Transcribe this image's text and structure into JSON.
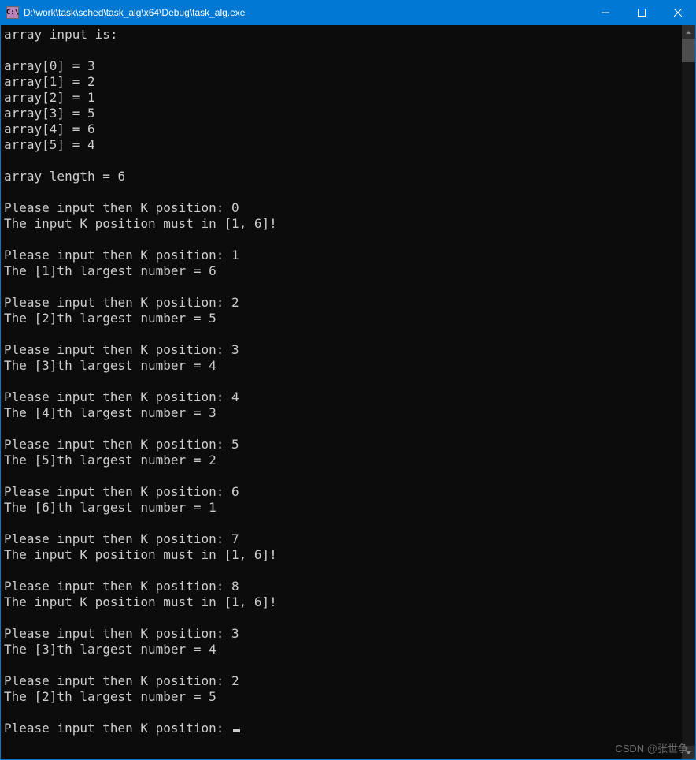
{
  "window": {
    "icon_text": "C:\\",
    "title": "D:\\work\\task\\sched\\task_alg\\x64\\Debug\\task_alg.exe"
  },
  "console": {
    "lines": [
      "array input is:",
      "",
      "array[0] = 3",
      "array[1] = 2",
      "array[2] = 1",
      "array[3] = 5",
      "array[4] = 6",
      "array[5] = 4",
      "",
      "array length = 6",
      "",
      "Please input then K position: 0",
      "The input K position must in [1, 6]!",
      "",
      "Please input then K position: 1",
      "The [1]th largest number = 6",
      "",
      "Please input then K position: 2",
      "The [2]th largest number = 5",
      "",
      "Please input then K position: 3",
      "The [3]th largest number = 4",
      "",
      "Please input then K position: 4",
      "The [4]th largest number = 3",
      "",
      "Please input then K position: 5",
      "The [5]th largest number = 2",
      "",
      "Please input then K position: 6",
      "The [6]th largest number = 1",
      "",
      "Please input then K position: 7",
      "The input K position must in [1, 6]!",
      "",
      "Please input then K position: 8",
      "The input K position must in [1, 6]!",
      "",
      "Please input then K position: 3",
      "The [3]th largest number = 4",
      "",
      "Please input then K position: 2",
      "The [2]th largest number = 5",
      "",
      "Please input then K position: "
    ]
  },
  "watermark": "CSDN @张世争"
}
